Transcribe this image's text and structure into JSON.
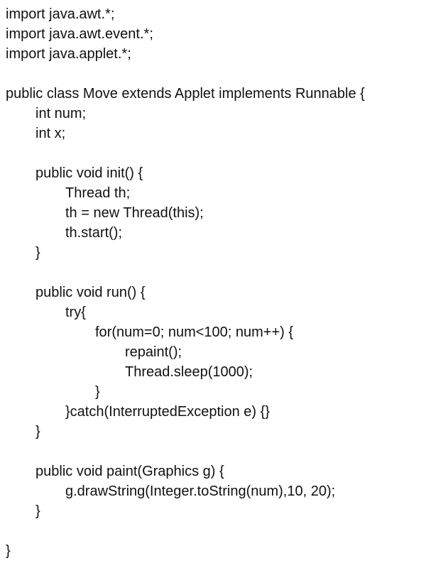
{
  "document": {
    "lines": [
      {
        "text": "import java.awt.*;",
        "indent": 0
      },
      {
        "text": "import java.awt.event.*;",
        "indent": 0
      },
      {
        "text": "import java.applet.*;",
        "indent": 0
      },
      {
        "text": "",
        "indent": 0
      },
      {
        "text": "public class Move extends Applet implements Runnable {",
        "indent": 0
      },
      {
        "text": "int num;",
        "indent": 1
      },
      {
        "text": "int x;",
        "indent": 1
      },
      {
        "text": "",
        "indent": 0
      },
      {
        "text": "public void init() {",
        "indent": 1
      },
      {
        "text": "Thread th;",
        "indent": 2
      },
      {
        "text": "th = new Thread(this);",
        "indent": 2
      },
      {
        "text": "th.start();",
        "indent": 2
      },
      {
        "text": "}",
        "indent": 1
      },
      {
        "text": "",
        "indent": 0
      },
      {
        "text": "public void run() {",
        "indent": 1
      },
      {
        "text": "try{",
        "indent": 2
      },
      {
        "text": "for(num=0; num<100; num++) {",
        "indent": 3
      },
      {
        "text": "repaint();",
        "indent": 4
      },
      {
        "text": "Thread.sleep(1000);",
        "indent": 4
      },
      {
        "text": "}",
        "indent": 3
      },
      {
        "text": "}catch(InterruptedException e) {}",
        "indent": 2
      },
      {
        "text": "}",
        "indent": 1
      },
      {
        "text": "",
        "indent": 0
      },
      {
        "text": "public void paint(Graphics g) {",
        "indent": 1
      },
      {
        "text": "g.drawString(Integer.toString(num),10, 20);",
        "indent": 2
      },
      {
        "text": "}",
        "indent": 1
      },
      {
        "text": "",
        "indent": 0
      },
      {
        "text": "}",
        "indent": 0
      }
    ]
  }
}
